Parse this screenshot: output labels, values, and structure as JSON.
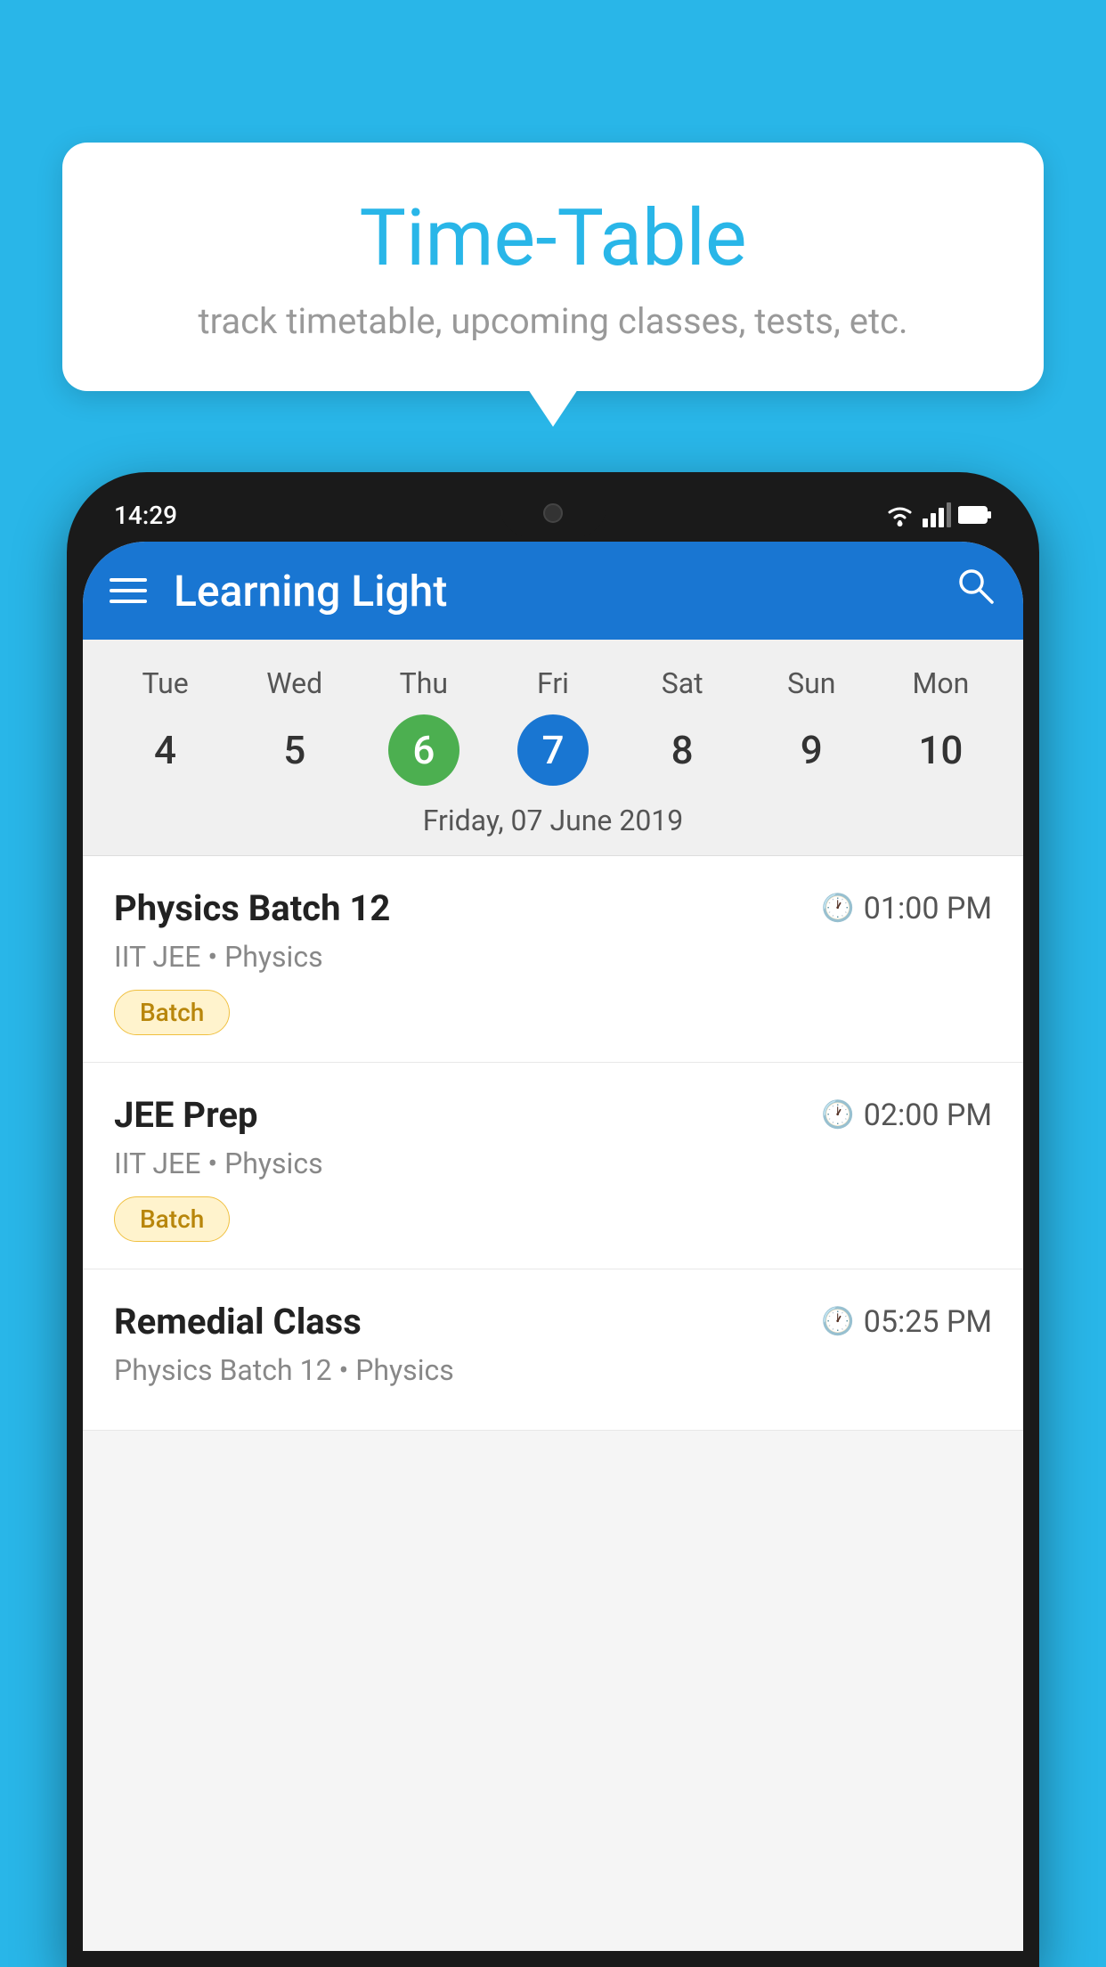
{
  "background": {
    "color": "#29B6E8"
  },
  "tooltip": {
    "title": "Time-Table",
    "subtitle": "track timetable, upcoming classes, tests, etc."
  },
  "phone": {
    "status": {
      "time": "14:29"
    },
    "app_bar": {
      "title": "Learning Light",
      "menu_icon": "menu-icon",
      "search_icon": "search-icon"
    },
    "calendar": {
      "days": [
        {
          "name": "Tue",
          "number": "4",
          "state": "normal"
        },
        {
          "name": "Wed",
          "number": "5",
          "state": "normal"
        },
        {
          "name": "Thu",
          "number": "6",
          "state": "today"
        },
        {
          "name": "Fri",
          "number": "7",
          "state": "selected"
        },
        {
          "name": "Sat",
          "number": "8",
          "state": "normal"
        },
        {
          "name": "Sun",
          "number": "9",
          "state": "normal"
        },
        {
          "name": "Mon",
          "number": "10",
          "state": "normal"
        }
      ],
      "selected_date_label": "Friday, 07 June 2019"
    },
    "classes": [
      {
        "name": "Physics Batch 12",
        "time": "01:00 PM",
        "subtitle": "IIT JEE • Physics",
        "badge": "Batch"
      },
      {
        "name": "JEE Prep",
        "time": "02:00 PM",
        "subtitle": "IIT JEE • Physics",
        "badge": "Batch"
      },
      {
        "name": "Remedial Class",
        "time": "05:25 PM",
        "subtitle": "Physics Batch 12 • Physics",
        "badge": null
      }
    ]
  }
}
